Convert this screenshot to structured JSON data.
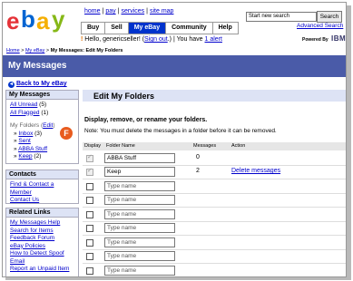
{
  "header": {
    "logo_letters": [
      "e",
      "b",
      "a",
      "y"
    ],
    "top_links": [
      "home",
      "pay",
      "services",
      "site map"
    ],
    "nav_tabs": [
      "Buy",
      "Sell",
      "My eBay",
      "Community",
      "Help"
    ],
    "active_tab": "My eBay",
    "search_placeholder": "Start new search",
    "search_button": "Search",
    "advanced_search": "Advanced Search",
    "hello_prefix": "Hello, genericseller! (",
    "sign_out": "Sign out",
    "hello_mid": ".) | You have ",
    "alert_link": "1 alert",
    "powered_by": "Powered By",
    "ibm": "IBM"
  },
  "breadcrumb": {
    "items": [
      "Home",
      "My eBay"
    ],
    "current": "My Messages: Edit My Folders"
  },
  "banner": {
    "title": "My Messages"
  },
  "back_link": "Back to My eBay",
  "sidebar": {
    "messages": {
      "title": "My Messages",
      "all_unread": "All Unread",
      "all_unread_count": "(5)",
      "all_flagged": "All Flagged",
      "all_flagged_count": "(1)",
      "my_folders": "My Folders",
      "edit_link": "Edit",
      "folders": [
        {
          "name": "Inbox",
          "count": "(3)"
        },
        {
          "name": "Sent",
          "count": ""
        },
        {
          "name": "ABBA Stuff",
          "count": ""
        },
        {
          "name": "Keep",
          "count": "(2)"
        }
      ]
    },
    "contacts": {
      "title": "Contacts",
      "links": [
        "Find & Contact a Member",
        "Contact Us"
      ]
    },
    "related": {
      "title": "Related Links",
      "links": [
        "My Messages Help",
        "Search for Items",
        "Feedback Forum",
        "eBay Policies",
        "How to Detect Spoof Email",
        "Report an Unpaid Item"
      ]
    },
    "badge": "F"
  },
  "main": {
    "title": "Edit My Folders",
    "description": "Display, remove, or rename your folders.",
    "note": "Note: You must delete the messages in a folder before it can be removed.",
    "columns": [
      "Display",
      "Folder Name",
      "Messages",
      "Action"
    ],
    "rows": [
      {
        "name": "ABBA Stuff",
        "messages": "0",
        "action": ""
      },
      {
        "name": "Keep",
        "messages": "2",
        "action": "Delete messages"
      },
      {
        "name": "Type name",
        "messages": "",
        "action": ""
      },
      {
        "name": "Type name",
        "messages": "",
        "action": ""
      },
      {
        "name": "Type name",
        "messages": "",
        "action": ""
      },
      {
        "name": "Type name",
        "messages": "",
        "action": ""
      },
      {
        "name": "Type name",
        "messages": "",
        "action": ""
      },
      {
        "name": "Type name",
        "messages": "",
        "action": ""
      },
      {
        "name": "Type name",
        "messages": "",
        "action": ""
      }
    ]
  },
  "colors": {
    "banner": "#4a5ba8",
    "active_tab": "#0033cc",
    "badge": "#e85b1e"
  }
}
